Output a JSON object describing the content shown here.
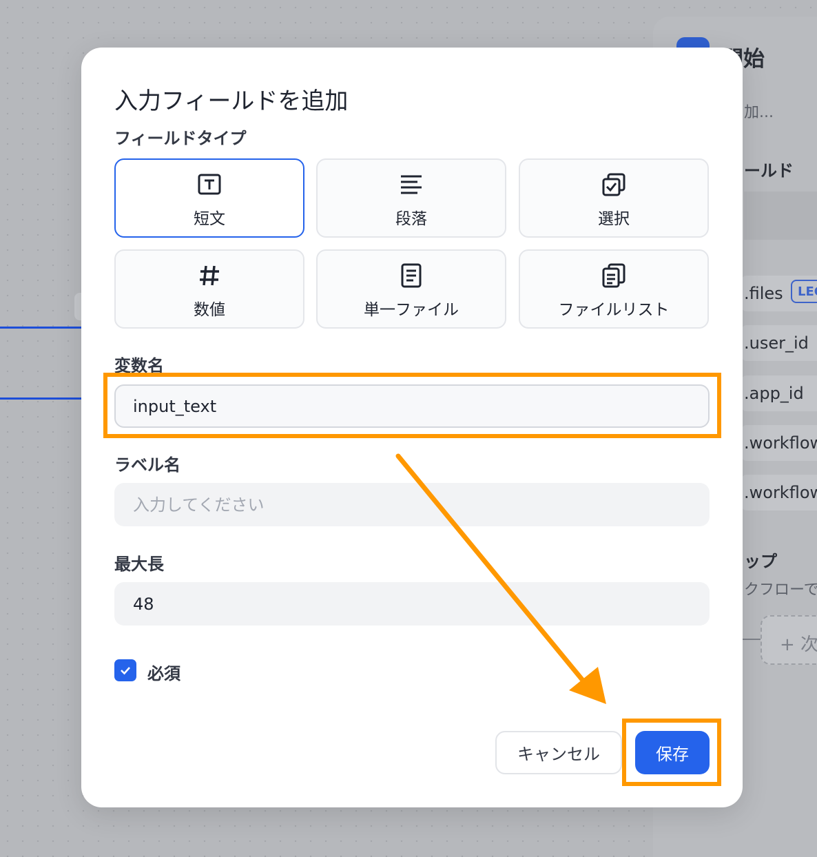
{
  "background": {
    "panel_title": "開始",
    "panel_description": "加...",
    "fields_heading": "ールド",
    "variables": [
      ".files",
      ".user_id",
      ".app_id",
      ".workflow",
      ".workflow"
    ],
    "badge": "LEG",
    "tip_heading": "ップ",
    "tip_text": "クフローで",
    "next_button": "+ 次"
  },
  "modal": {
    "title": "入力フィールドを追加",
    "field_type_label": "フィールドタイプ",
    "field_types": [
      {
        "label": "短文",
        "icon": "text-box-icon",
        "selected": true
      },
      {
        "label": "段落",
        "icon": "paragraph-icon",
        "selected": false
      },
      {
        "label": "選択",
        "icon": "multi-select-icon",
        "selected": false
      },
      {
        "label": "数値",
        "icon": "hash-icon",
        "selected": false
      },
      {
        "label": "単一ファイル",
        "icon": "file-icon",
        "selected": false
      },
      {
        "label": "ファイルリスト",
        "icon": "file-list-icon",
        "selected": false
      }
    ],
    "variable_name_label": "変数名",
    "variable_name_value": "input_text",
    "label_name_label": "ラベル名",
    "label_name_placeholder": "入力してください",
    "max_length_label": "最大長",
    "max_length_value": "48",
    "required_label": "必須",
    "required_checked": true,
    "cancel_label": "キャンセル",
    "save_label": "保存"
  },
  "colors": {
    "accent": "#2563eb",
    "annotation": "#ff9800"
  }
}
